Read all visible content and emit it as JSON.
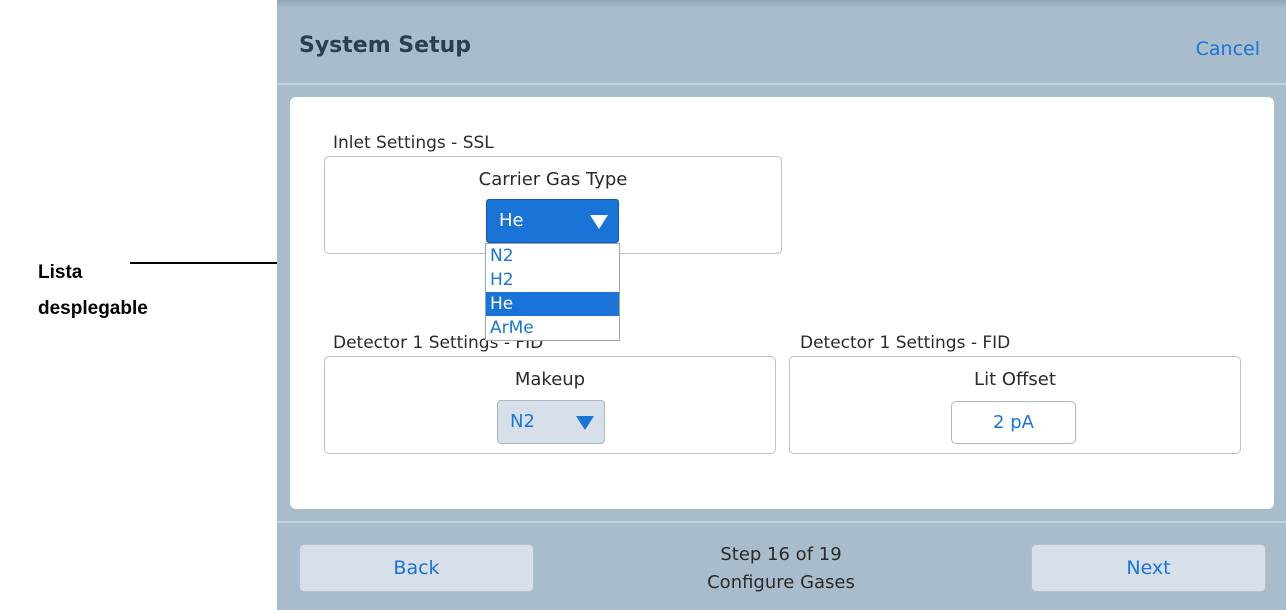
{
  "callout": {
    "line1": "Lista",
    "line2": "desplegable"
  },
  "header": {
    "title": "System Setup",
    "cancel_label": "Cancel"
  },
  "inlet": {
    "group_label": "Inlet Settings - SSL",
    "field_label": "Carrier Gas Type",
    "selected_value": "He",
    "options": [
      "N2",
      "H2",
      "He",
      "ArMe"
    ],
    "selected_index": 2
  },
  "detector_makeup": {
    "group_label": "Detector 1 Settings - FID",
    "field_label": "Makeup",
    "selected_value": "N2"
  },
  "detector_lit": {
    "group_label": "Detector 1 Settings - FID",
    "field_label": "Lit Offset",
    "value": "2 pA"
  },
  "footer": {
    "back_label": "Back",
    "next_label": "Next",
    "step_text": "Step 16 of 19",
    "step_title": "Configure Gases"
  },
  "colors": {
    "screen_bg": "#a8bccb",
    "accent": "#1a73d6",
    "button_bg": "#d7e0e8",
    "title_text": "#2c3e50"
  }
}
